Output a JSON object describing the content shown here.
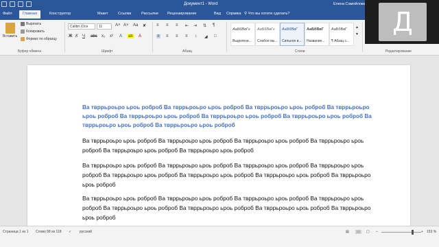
{
  "title_bar": {
    "document_title": "Документ1 - Word",
    "user_name": "Елена Самойлова"
  },
  "tabs": [
    {
      "label": "Файл"
    },
    {
      "label": "Главная"
    },
    {
      "label": "Конструктор"
    },
    {
      "label": "Макет"
    },
    {
      "label": "Ссылки"
    },
    {
      "label": "Рассылки"
    },
    {
      "label": "Рецензирование"
    },
    {
      "label": "Вид"
    },
    {
      "label": "Справка"
    }
  ],
  "tell_me": "Что вы хотите сделать?",
  "ribbon": {
    "clipboard": {
      "paste": "Вставить",
      "cut": "Вырезать",
      "copy": "Копировать",
      "format_painter": "Формат по образцу",
      "label": "Буфер обмена"
    },
    "font": {
      "font_name": "Calibri (Осн",
      "font_size": "11",
      "label": "Шрифт"
    },
    "paragraph": {
      "label": "Абзац"
    },
    "styles": {
      "label": "Стили",
      "items": [
        {
          "sample": "АаБбВвГг",
          "name": "Выделени..."
        },
        {
          "sample": "АаБбВвГг",
          "name": "Слабое вы..."
        },
        {
          "sample": "АаБбВвГ",
          "name": "Сильное в..."
        },
        {
          "sample": "АаБбВвГ",
          "name": "Название..."
        },
        {
          "sample": "АаБбВвГ",
          "name": "¶ Абзац с..."
        }
      ]
    },
    "editing": {
      "label": "Редактирование"
    }
  },
  "document": {
    "heading": "Ва твррьроьро ьроь роброб Ва твррьроьро ьроь роброб Ва твррьроьро ьроь роброб Ва твррьроьро ьроь роброб Ва твррьроьро ьроь роброб Ва твррьроьро ьроь роброб Ва твррьроьро ьроь роброб Ва твррьроьро ьроь роброб Ва твррьроьро ьроь роброб",
    "paragraphs": [
      "Ва твррьроьро ьроь роброб Ва твррьроьро ьроь роброб Ва твррьроьро ьроь роброб Ва твррьроьро ьроь роброб Ва твррьроьро ьроь роброб Ва твррьроьро ьроь роброб",
      "Ва твррьроьро ьроь роброб Ва твррьроьро ьроь роброб Ва твррьроьро ьроь роброб Ва твррьроьро ьроь роброб Ва твррьроьро ьроь роброб Ва твррьроьро ьроь роброб Ва твррьроьро ьроь роброб Ва твррьроьро ьроь роброб",
      "Ва твррьроьро ьроь роброб Ва твррьроьро ьроь роброб Ва твррьроьро ьроь роброб Ва твррьроьро ьроь роброб Ва твррьроьро ьроь роброб Ва твррьроьро ьроь роброб Ва твррьроьро ьроь роброб Ва твррьроьро ьроь роброб"
    ]
  },
  "status": {
    "page": "Страница 1 из 1",
    "words": "Слово 58 из 118",
    "language": "русский",
    "zoom": "153 %"
  },
  "webcam": {
    "initial": "Д"
  },
  "colors": {
    "accent": "#2b579a",
    "heading": "#4472c4"
  }
}
